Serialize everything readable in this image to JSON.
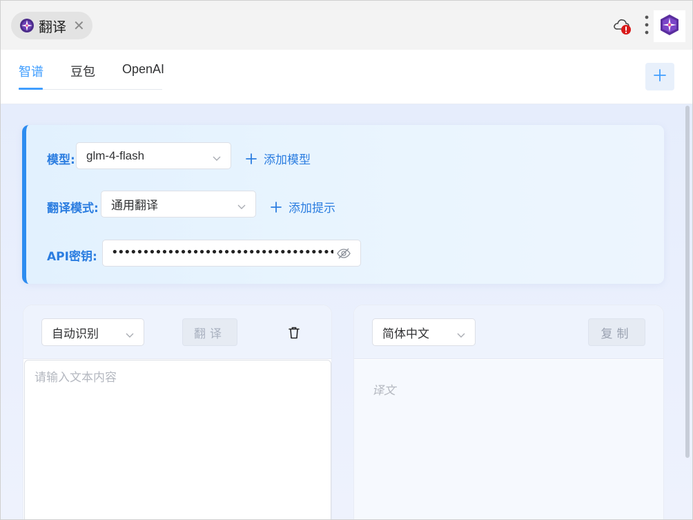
{
  "window": {
    "tab_title": "翻译",
    "tab_icon": "app-compass-icon",
    "close_glyph": "✕"
  },
  "titlebar_icons": [
    "cloud-error-icon",
    "more-vertical-icon",
    "avatar-icon"
  ],
  "header": {
    "tabs": [
      {
        "label": "智谱",
        "active": true
      },
      {
        "label": "豆包",
        "active": false
      },
      {
        "label": "OpenAI",
        "active": false
      }
    ],
    "add_tab_icon": "plus-icon"
  },
  "config": {
    "model_label": "模型:",
    "model_value": "glm-4-flash",
    "add_model_label": "添加模型",
    "mode_label": "翻译模式:",
    "mode_value": "通用翻译",
    "add_prompt_label": "添加提示",
    "api_label": "API密钥:",
    "api_value": "••••••••••••••••••••••••••••••••••••••••••••••••••••••"
  },
  "source": {
    "language": "自动识别",
    "translate_button": "翻译",
    "input_placeholder": "请输入文本内容"
  },
  "target": {
    "language": "简体中文",
    "copy_button": "复制",
    "output_placeholder": "译文"
  },
  "colors": {
    "accent": "#409eff",
    "label_blue": "#2b7de0",
    "error_red": "#d91a1a"
  }
}
